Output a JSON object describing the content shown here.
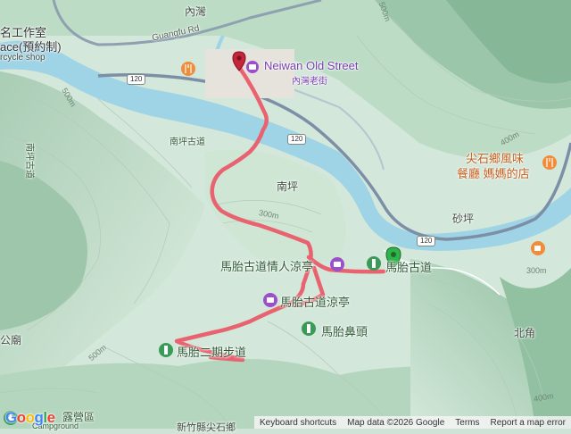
{
  "map": {
    "type": "terrain",
    "colors": {
      "route": "#e8636f",
      "water": "#9fd3e6",
      "road": "#7d8fa6",
      "terrain_light": "#dceee2",
      "terrain_dark": "#9fc7ad"
    }
  },
  "labels": {
    "neiwan_top": "內灣",
    "guangfu_rd": "Guangfu Rd",
    "studio_top": "名工作室",
    "studio_mid": "ace(預約制)",
    "studio_bot": "rcycle shop",
    "old_street_en": "Neiwan Old Street",
    "old_street_cn": "內灣老街",
    "nanping_old_trail": "南坪古道",
    "nanping_trail_side": "南坪古道",
    "nanping": "南坪",
    "restaurant_1": "尖石鄉風味",
    "restaurant_2": "餐廳 媽媽的店",
    "shaping": "砂坪",
    "lovers_pavilion": "馬胎古道情人涼亭",
    "ancient_pavilion": "馬胎古道涼亭",
    "matai_trail": "馬胎古道",
    "matai_nose": "馬胎鼻頭",
    "matai_phase2": "馬胎二期步道",
    "beijiao": "北角",
    "gongmiao": "公廟",
    "camp": "露營區",
    "bottom_town": "新竹縣尖石鄉",
    "camp_en": "Campground"
  },
  "roads": {
    "r120_a": "120",
    "r120_b": "120",
    "r120_c": "120"
  },
  "elevations": {
    "e500_top": "500m",
    "e500_left": "500m",
    "e300": "300m",
    "e400_right": "400m",
    "e300_right": "300m",
    "e400_bottom": "400m",
    "e500_bottom": "500m"
  },
  "footer": {
    "keyboard": "Keyboard shortcuts",
    "mapdata": "Map data ©2026 Google",
    "terms": "Terms",
    "report": "Report a map error"
  },
  "logo": "Google"
}
